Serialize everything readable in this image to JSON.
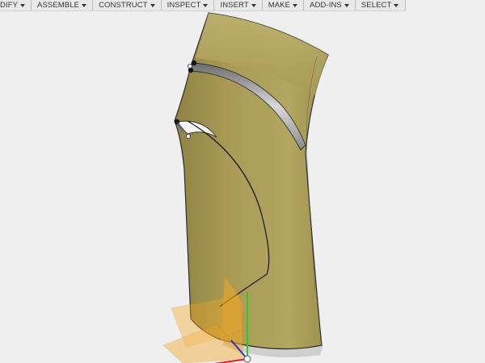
{
  "toolbar": {
    "menus": [
      {
        "label": "DIFY"
      },
      {
        "label": "ASSEMBLE"
      },
      {
        "label": "CONSTRUCT"
      },
      {
        "label": "INSPECT"
      },
      {
        "label": "INSERT"
      },
      {
        "label": "MAKE"
      },
      {
        "label": "ADD-INS"
      },
      {
        "label": "SELECT"
      }
    ]
  },
  "colors": {
    "viewport_background": "#efefef",
    "body_fill": "#a99b55",
    "body_highlight": "#c4b774",
    "edge": "#2d2d2d",
    "plane_fill": "#f5a623",
    "axis_y": "#22cc22",
    "axis_x": "#dd2222",
    "axis_z": "#2233cc"
  },
  "icons": {
    "menu_caret": "caret-down-icon"
  }
}
